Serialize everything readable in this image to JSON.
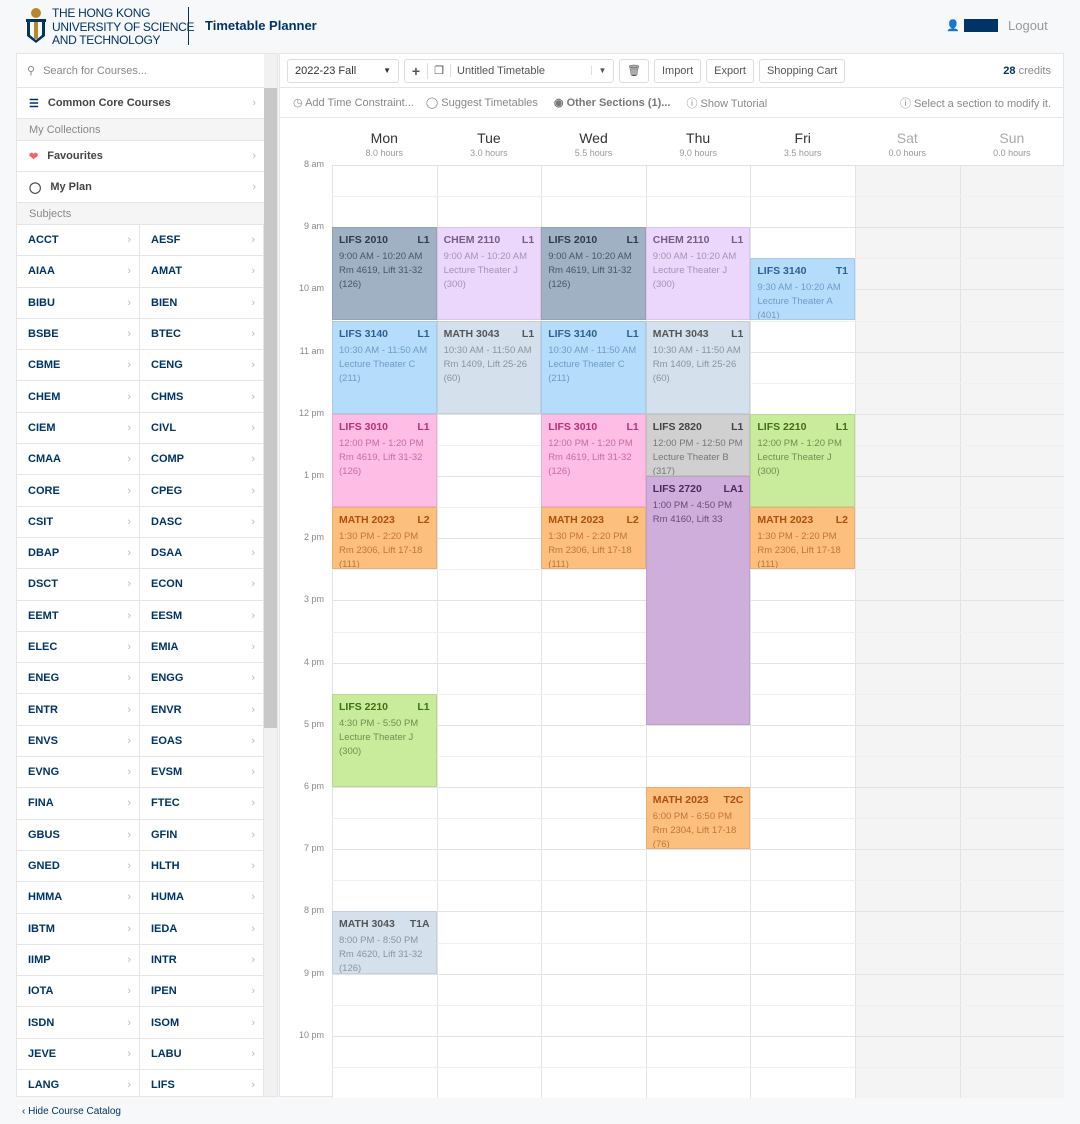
{
  "header": {
    "university": [
      "THE HONG KONG",
      "UNIVERSITY OF SCIENCE",
      "AND TECHNOLOGY"
    ],
    "app_title": "Timetable Planner",
    "logout": "Logout"
  },
  "sidebar": {
    "search_placeholder": "Search for Courses...",
    "common_core": "Common Core Courses",
    "my_collections": "My Collections",
    "favourites": "Favourites",
    "my_plan": "My Plan",
    "subjects_label": "Subjects",
    "subjects": [
      "ACCT",
      "AESF",
      "AIAA",
      "AMAT",
      "BIBU",
      "BIEN",
      "BSBE",
      "BTEC",
      "CBME",
      "CENG",
      "CHEM",
      "CHMS",
      "CIEM",
      "CIVL",
      "CMAA",
      "COMP",
      "CORE",
      "CPEG",
      "CSIT",
      "DASC",
      "DBAP",
      "DSAA",
      "DSCT",
      "ECON",
      "EEMT",
      "EESM",
      "ELEC",
      "EMIA",
      "ENEG",
      "ENGG",
      "ENTR",
      "ENVR",
      "ENVS",
      "EOAS",
      "EVNG",
      "EVSM",
      "FINA",
      "FTEC",
      "GBUS",
      "GFIN",
      "GNED",
      "HLTH",
      "HMMA",
      "HUMA",
      "IBTM",
      "IEDA",
      "IIMP",
      "INTR",
      "IOTA",
      "IPEN",
      "ISDN",
      "ISOM",
      "JEVE",
      "LABU",
      "LANG",
      "LIFS"
    ],
    "hide_catalog": "Hide Course Catalog"
  },
  "toolbar": {
    "term": "2022-23 Fall",
    "timetable_name": "Untitled Timetable",
    "import": "Import",
    "export": "Export",
    "shopping_cart": "Shopping Cart",
    "credits_value": "28",
    "credits_label": "credits"
  },
  "toolbar2": {
    "add_constraint": "Add Time Constraint...",
    "suggest": "Suggest Timetables",
    "other_sections": "Other Sections (1)...",
    "tutorial": "Show Tutorial",
    "hint": "Select a section to modify it."
  },
  "days": [
    {
      "name": "Mon",
      "hours": "8.0 hours"
    },
    {
      "name": "Tue",
      "hours": "3.0 hours"
    },
    {
      "name": "Wed",
      "hours": "5.5 hours"
    },
    {
      "name": "Thu",
      "hours": "9.0 hours"
    },
    {
      "name": "Fri",
      "hours": "3.5 hours"
    },
    {
      "name": "Sat",
      "hours": "0.0 hours"
    },
    {
      "name": "Sun",
      "hours": "0.0 hours"
    }
  ],
  "time_labels": [
    "8 am",
    "9 am",
    "10 am",
    "11 am",
    "12 pm",
    "1 pm",
    "2 pm",
    "3 pm",
    "4 pm",
    "5 pm",
    "6 pm",
    "7 pm",
    "8 pm",
    "9 pm",
    "10 pm"
  ],
  "colors": {
    "LIFS 2010": [
      "#a0b1c4",
      "#2f3b48",
      "#4a5563"
    ],
    "CHEM 2110": [
      "#ecd7fc",
      "#7a5a8a",
      "#a890b4"
    ],
    "LIFS 3140": [
      "#b6dcfb",
      "#2d5f96",
      "#6d9cc8"
    ],
    "MATH 3043": [
      "#d4e1ed",
      "#555",
      "#8a949e"
    ],
    "LIFS 3010": [
      "#fdbde4",
      "#b8336f",
      "#c76e9c"
    ],
    "MATH 2023": [
      "#fdbf7e",
      "#b24e10",
      "#c2743a"
    ],
    "LIFS 2820": [
      "#d0d0d0",
      "#444",
      "#777"
    ],
    "LIFS 2720": [
      "#d0aedc",
      "#4a2c5a",
      "#6a4a7a"
    ],
    "LIFS 2210": [
      "#c8ec9c",
      "#3f6f14",
      "#6e8f50"
    ]
  },
  "events": [
    {
      "day": 0,
      "course": "LIFS 2010",
      "section": "L1",
      "start": "9:00",
      "end": "10:20",
      "time": "9:00 AM - 10:20 AM",
      "venue": "Rm 4619, Lift 31-32",
      "quota": "(126)"
    },
    {
      "day": 0,
      "course": "LIFS 3140",
      "section": "L1",
      "start": "10:30",
      "end": "11:50",
      "time": "10:30 AM - 11:50 AM",
      "venue": "Lecture Theater C",
      "quota": "(211)"
    },
    {
      "day": 0,
      "course": "LIFS 3010",
      "section": "L1",
      "start": "12:00",
      "end": "13:20",
      "time": "12:00 PM - 1:20 PM",
      "venue": "Rm 4619, Lift 31-32",
      "quota": "(126)"
    },
    {
      "day": 0,
      "course": "MATH 2023",
      "section": "L2",
      "start": "13:30",
      "end": "14:20",
      "time": "1:30 PM - 2:20 PM",
      "venue": "Rm 2306, Lift 17-18",
      "quota": "(111)"
    },
    {
      "day": 0,
      "course": "LIFS 2210",
      "section": "L1",
      "start": "16:30",
      "end": "17:50",
      "time": "4:30 PM - 5:50 PM",
      "venue": "Lecture Theater J",
      "quota": "(300)"
    },
    {
      "day": 0,
      "course": "MATH 3043",
      "section": "T1A",
      "start": "20:00",
      "end": "20:50",
      "time": "8:00 PM - 8:50 PM",
      "venue": "Rm 4620, Lift 31-32",
      "quota": "(126)"
    },
    {
      "day": 1,
      "course": "CHEM 2110",
      "section": "L1",
      "start": "9:00",
      "end": "10:20",
      "time": "9:00 AM - 10:20 AM",
      "venue": "Lecture Theater J",
      "quota": "(300)"
    },
    {
      "day": 1,
      "course": "MATH 3043",
      "section": "L1",
      "start": "10:30",
      "end": "11:50",
      "time": "10:30 AM - 11:50 AM",
      "venue": "Rm 1409, Lift 25-26",
      "quota": "(60)"
    },
    {
      "day": 2,
      "course": "LIFS 2010",
      "section": "L1",
      "start": "9:00",
      "end": "10:20",
      "time": "9:00 AM - 10:20 AM",
      "venue": "Rm 4619, Lift 31-32",
      "quota": "(126)"
    },
    {
      "day": 2,
      "course": "LIFS 3140",
      "section": "L1",
      "start": "10:30",
      "end": "11:50",
      "time": "10:30 AM - 11:50 AM",
      "venue": "Lecture Theater C",
      "quota": "(211)"
    },
    {
      "day": 2,
      "course": "LIFS 3010",
      "section": "L1",
      "start": "12:00",
      "end": "13:20",
      "time": "12:00 PM - 1:20 PM",
      "venue": "Rm 4619, Lift 31-32",
      "quota": "(126)"
    },
    {
      "day": 2,
      "course": "MATH 2023",
      "section": "L2",
      "start": "13:30",
      "end": "14:20",
      "time": "1:30 PM - 2:20 PM",
      "venue": "Rm 2306, Lift 17-18",
      "quota": "(111)"
    },
    {
      "day": 3,
      "course": "CHEM 2110",
      "section": "L1",
      "start": "9:00",
      "end": "10:20",
      "time": "9:00 AM - 10:20 AM",
      "venue": "Lecture Theater J",
      "quota": "(300)"
    },
    {
      "day": 3,
      "course": "MATH 3043",
      "section": "L1",
      "start": "10:30",
      "end": "11:50",
      "time": "10:30 AM - 11:50 AM",
      "venue": "Rm 1409, Lift 25-26",
      "quota": "(60)"
    },
    {
      "day": 3,
      "course": "LIFS 2820",
      "section": "L1",
      "start": "12:00",
      "end": "12:50",
      "time": "12:00 PM - 12:50 PM",
      "venue": "Lecture Theater B",
      "quota": "(317)"
    },
    {
      "day": 3,
      "course": "LIFS 2720",
      "section": "LA1",
      "start": "13:00",
      "end": "16:50",
      "time": "1:00 PM - 4:50 PM",
      "venue": "Rm 4160, Lift 33",
      "quota": ""
    },
    {
      "day": 3,
      "course": "MATH 2023",
      "section": "T2C",
      "start": "18:00",
      "end": "18:50",
      "time": "6:00 PM - 6:50 PM",
      "venue": "Rm 2304, Lift 17-18",
      "quota": "(76)"
    },
    {
      "day": 4,
      "course": "LIFS 3140",
      "section": "T1",
      "start": "9:30",
      "end": "10:20",
      "time": "9:30 AM - 10:20 AM",
      "venue": "Lecture Theater A",
      "quota": "(401)"
    },
    {
      "day": 4,
      "course": "LIFS 2210",
      "section": "L1",
      "start": "12:00",
      "end": "13:20",
      "time": "12:00 PM - 1:20 PM",
      "venue": "Lecture Theater J",
      "quota": "(300)"
    },
    {
      "day": 4,
      "course": "MATH 2023",
      "section": "L2",
      "start": "13:30",
      "end": "14:20",
      "time": "1:30 PM - 2:20 PM",
      "venue": "Rm 2306, Lift 17-18",
      "quota": "(111)"
    }
  ]
}
